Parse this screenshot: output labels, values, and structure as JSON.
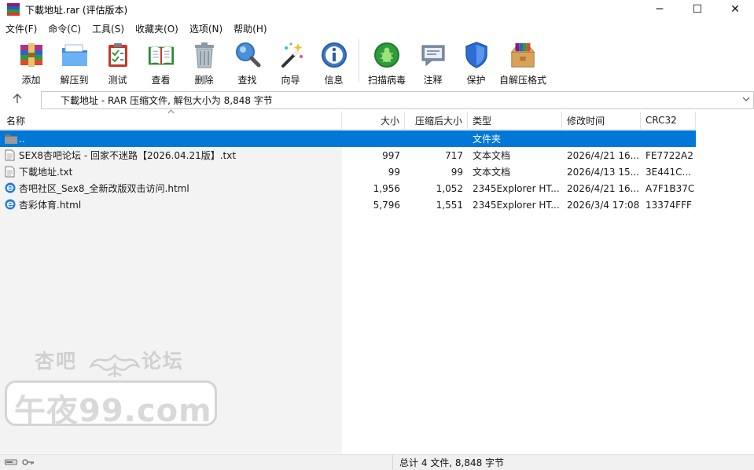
{
  "window": {
    "title": "下載地址.rar (评估版本)",
    "controls": {
      "minimize": "─",
      "maximize": "☐",
      "close": "✕"
    }
  },
  "menu": [
    "文件(F)",
    "命令(C)",
    "工具(S)",
    "收藏夹(O)",
    "选项(N)",
    "帮助(H)"
  ],
  "toolbar": [
    {
      "label": "添加",
      "icon": "add-archive-icon"
    },
    {
      "label": "解压到",
      "icon": "extract-folder-icon"
    },
    {
      "label": "测试",
      "icon": "test-clipboard-icon"
    },
    {
      "label": "查看",
      "icon": "view-book-icon"
    },
    {
      "label": "删除",
      "icon": "trash-bin-icon"
    },
    {
      "label": "查找",
      "icon": "magnifier-icon"
    },
    {
      "label": "向导",
      "icon": "wizard-wand-icon"
    },
    {
      "label": "信息",
      "icon": "info-icon"
    },
    {
      "label": "扫描病毒",
      "icon": "virus-scan-icon"
    },
    {
      "label": "注释",
      "icon": "comment-icon"
    },
    {
      "label": "保护",
      "icon": "shield-icon"
    },
    {
      "label": "自解压格式",
      "icon": "sfx-box-icon"
    }
  ],
  "address": {
    "text": "下載地址 - RAR 压缩文件, 解包大小为 8,848 字节"
  },
  "columns": {
    "name": "名称",
    "size": "大小",
    "packed": "压缩后大小",
    "type": "类型",
    "mtime": "修改时间",
    "crc": "CRC32"
  },
  "files": [
    {
      "name": "..",
      "size": "",
      "packed": "",
      "type": "文件夹",
      "mtime": "",
      "crc": "",
      "icon": "folder-icon",
      "selected": true
    },
    {
      "name": "SEX8杏吧论坛 - 回家不迷路【2026.04.21版】.txt",
      "size": "997",
      "packed": "717",
      "type": "文本文档",
      "mtime": "2026/4/21 16...",
      "crc": "FE7722A2",
      "icon": "text-file-icon"
    },
    {
      "name": "下載地址.txt",
      "size": "99",
      "packed": "99",
      "type": "文本文档",
      "mtime": "2026/4/13 15...",
      "crc": "3E441C...",
      "icon": "text-file-icon"
    },
    {
      "name": "杏吧社区_Sex8_全新改版双击访问.html",
      "size": "1,956",
      "packed": "1,052",
      "type": "2345Explorer HT...",
      "mtime": "2026/4/21 16...",
      "crc": "A7F1B37C",
      "icon": "browser-html-icon"
    },
    {
      "name": "杏彩体育.html",
      "size": "5,796",
      "packed": "1,551",
      "type": "2345Explorer HT...",
      "mtime": "2026/3/4 17:08",
      "crc": "13374FFF",
      "icon": "browser-html-icon"
    }
  ],
  "watermark": {
    "top_left": "杏吧",
    "top_right": "论坛",
    "main": "午夜99.com"
  },
  "status": {
    "text": "总计 4 文件, 8,848 字节"
  },
  "colors": {
    "selection": "#0078d7",
    "left_pane": "#f3f3f3",
    "statusbar": "#f0f0f0"
  }
}
